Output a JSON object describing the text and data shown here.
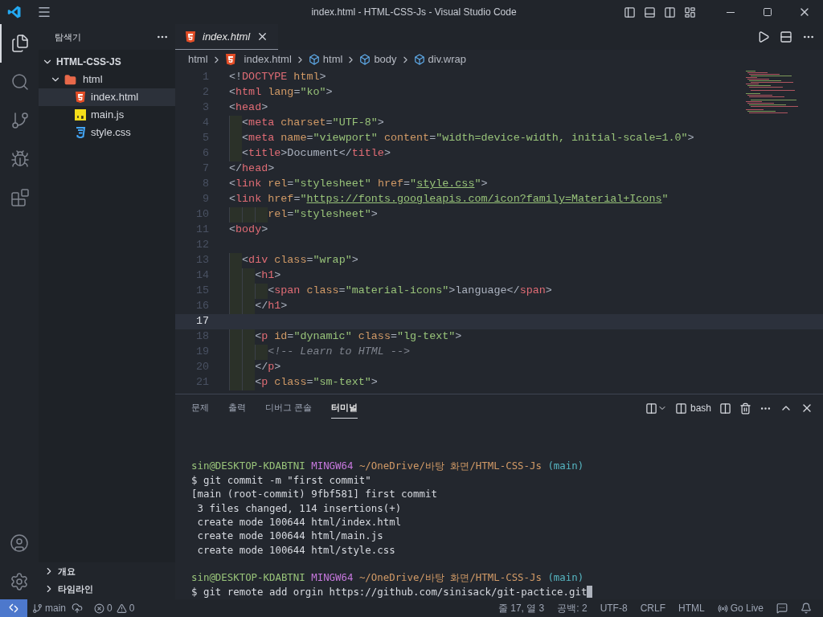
{
  "window": {
    "title": "index.html - HTML-CSS-Js - Visual Studio Code"
  },
  "activity_bar": [
    {
      "kind": "explorer",
      "selected": true
    },
    {
      "kind": "search",
      "selected": false
    },
    {
      "kind": "source-control",
      "selected": false
    },
    {
      "kind": "run",
      "selected": false
    },
    {
      "kind": "extensions",
      "selected": false
    }
  ],
  "sidebar": {
    "title": "탐색기",
    "tree": [
      {
        "label": "HTML-CSS-JS",
        "kind": "root",
        "expanded": true,
        "children": [
          {
            "label": "html",
            "kind": "folder",
            "expanded": true,
            "selected": false,
            "children": [
              {
                "label": "index.html",
                "kind": "html",
                "selected": true
              },
              {
                "label": "main.js",
                "kind": "js",
                "selected": false
              },
              {
                "label": "style.css",
                "kind": "css",
                "selected": false
              }
            ]
          }
        ]
      }
    ],
    "sections": [
      {
        "label": "개요",
        "expanded": false
      },
      {
        "label": "타임라인",
        "expanded": false
      }
    ]
  },
  "tabs": [
    {
      "label": "index.html",
      "kind": "html",
      "selected": true
    }
  ],
  "breadcrumbs": [
    {
      "label": "html",
      "kind": "folder"
    },
    {
      "label": "index.html",
      "kind": "html"
    },
    {
      "label": "html",
      "kind": "element"
    },
    {
      "label": "body",
      "kind": "element"
    },
    {
      "label": "div.wrap",
      "kind": "element"
    }
  ],
  "editor": {
    "lines": [
      {
        "number": "1",
        "current": false,
        "tokens": [
          {
            "kind": "punct",
            "text": "<!"
          },
          {
            "kind": "tag",
            "text": "DOCTYPE"
          },
          {
            "kind": "attr",
            "text": " html"
          },
          {
            "kind": "punct",
            "text": ">"
          }
        ]
      },
      {
        "number": "2",
        "current": false,
        "tokens": [
          {
            "kind": "punct",
            "text": "<"
          },
          {
            "kind": "tag",
            "text": "html"
          },
          {
            "kind": "attr",
            "text": " lang"
          },
          {
            "kind": "punct",
            "text": "="
          },
          {
            "kind": "string",
            "text": "\"ko\""
          },
          {
            "kind": "punct",
            "text": ">"
          }
        ]
      },
      {
        "number": "3",
        "current": false,
        "tokens": [
          {
            "kind": "punct",
            "text": "<"
          },
          {
            "kind": "tag",
            "text": "head"
          },
          {
            "kind": "punct",
            "text": ">"
          }
        ]
      },
      {
        "number": "4",
        "current": false,
        "tokens": [
          {
            "kind": "punct",
            "text": "  <"
          },
          {
            "kind": "tag",
            "text": "meta"
          },
          {
            "kind": "attr",
            "text": " charset"
          },
          {
            "kind": "punct",
            "text": "="
          },
          {
            "kind": "string",
            "text": "\"UTF-8\""
          },
          {
            "kind": "punct",
            "text": ">"
          }
        ]
      },
      {
        "number": "5",
        "current": false,
        "tokens": [
          {
            "kind": "punct",
            "text": "  <"
          },
          {
            "kind": "tag",
            "text": "meta"
          },
          {
            "kind": "attr",
            "text": " name"
          },
          {
            "kind": "punct",
            "text": "="
          },
          {
            "kind": "string",
            "text": "\"viewport\""
          },
          {
            "kind": "attr",
            "text": " content"
          },
          {
            "kind": "punct",
            "text": "="
          },
          {
            "kind": "string",
            "text": "\"width=device-width, initial-scale=1.0\""
          },
          {
            "kind": "punct",
            "text": ">"
          }
        ]
      },
      {
        "number": "6",
        "current": false,
        "tokens": [
          {
            "kind": "punct",
            "text": "  <"
          },
          {
            "kind": "tag",
            "text": "title"
          },
          {
            "kind": "punct",
            "text": ">"
          },
          {
            "kind": "text",
            "text": "Document"
          },
          {
            "kind": "punct",
            "text": "</"
          },
          {
            "kind": "tag",
            "text": "title"
          },
          {
            "kind": "punct",
            "text": ">"
          }
        ]
      },
      {
        "number": "7",
        "current": false,
        "tokens": [
          {
            "kind": "punct",
            "text": "</"
          },
          {
            "kind": "tag",
            "text": "head"
          },
          {
            "kind": "punct",
            "text": ">"
          }
        ]
      },
      {
        "number": "8",
        "current": false,
        "tokens": [
          {
            "kind": "punct",
            "text": "<"
          },
          {
            "kind": "tag",
            "text": "link"
          },
          {
            "kind": "attr",
            "text": " rel"
          },
          {
            "kind": "punct",
            "text": "="
          },
          {
            "kind": "string",
            "text": "\"stylesheet\""
          },
          {
            "kind": "attr",
            "text": " href"
          },
          {
            "kind": "punct",
            "text": "="
          },
          {
            "kind": "string",
            "text": "\""
          },
          {
            "kind": "link",
            "text": "style.css"
          },
          {
            "kind": "string",
            "text": "\""
          },
          {
            "kind": "punct",
            "text": ">"
          }
        ]
      },
      {
        "number": "9",
        "current": false,
        "tokens": [
          {
            "kind": "punct",
            "text": "<"
          },
          {
            "kind": "tag",
            "text": "link"
          },
          {
            "kind": "attr",
            "text": " href"
          },
          {
            "kind": "punct",
            "text": "="
          },
          {
            "kind": "string",
            "text": "\""
          },
          {
            "kind": "link",
            "text": "https://fonts.googleapis.com/icon?family=Material+Icons"
          },
          {
            "kind": "string",
            "text": "\""
          }
        ]
      },
      {
        "number": "10",
        "current": false,
        "tokens": [
          {
            "kind": "attr",
            "text": "      rel"
          },
          {
            "kind": "punct",
            "text": "="
          },
          {
            "kind": "string",
            "text": "\"stylesheet\""
          },
          {
            "kind": "punct",
            "text": ">"
          }
        ]
      },
      {
        "number": "11",
        "current": false,
        "tokens": [
          {
            "kind": "punct",
            "text": "<"
          },
          {
            "kind": "tag",
            "text": "body"
          },
          {
            "kind": "punct",
            "text": ">"
          }
        ]
      },
      {
        "number": "12",
        "current": false
      },
      {
        "number": "13",
        "current": false,
        "tokens": [
          {
            "kind": "punct",
            "text": "  <"
          },
          {
            "kind": "tag",
            "text": "div"
          },
          {
            "kind": "attr",
            "text": " class"
          },
          {
            "kind": "punct",
            "text": "="
          },
          {
            "kind": "string",
            "text": "\"wrap\""
          },
          {
            "kind": "punct",
            "text": ">"
          }
        ]
      },
      {
        "number": "14",
        "current": false,
        "tokens": [
          {
            "kind": "punct",
            "text": "    <"
          },
          {
            "kind": "tag",
            "text": "h1"
          },
          {
            "kind": "punct",
            "text": ">"
          }
        ]
      },
      {
        "number": "15",
        "current": false,
        "tokens": [
          {
            "kind": "punct",
            "text": "      <"
          },
          {
            "kind": "tag",
            "text": "span"
          },
          {
            "kind": "attr",
            "text": " class"
          },
          {
            "kind": "punct",
            "text": "="
          },
          {
            "kind": "string",
            "text": "\"material-icons\""
          },
          {
            "kind": "punct",
            "text": ">"
          },
          {
            "kind": "text",
            "text": "language"
          },
          {
            "kind": "punct",
            "text": "</"
          },
          {
            "kind": "tag",
            "text": "span"
          },
          {
            "kind": "punct",
            "text": ">"
          }
        ]
      },
      {
        "number": "16",
        "current": false,
        "tokens": [
          {
            "kind": "punct",
            "text": "    </"
          },
          {
            "kind": "tag",
            "text": "h1"
          },
          {
            "kind": "punct",
            "text": ">"
          }
        ]
      },
      {
        "number": "17",
        "current": true
      },
      {
        "number": "18",
        "current": false,
        "tokens": [
          {
            "kind": "punct",
            "text": "    <"
          },
          {
            "kind": "tag",
            "text": "p"
          },
          {
            "kind": "attr",
            "text": " id"
          },
          {
            "kind": "punct",
            "text": "="
          },
          {
            "kind": "string",
            "text": "\"dynamic\""
          },
          {
            "kind": "attr",
            "text": " class"
          },
          {
            "kind": "punct",
            "text": "="
          },
          {
            "kind": "string",
            "text": "\"lg-text\""
          },
          {
            "kind": "punct",
            "text": ">"
          }
        ]
      },
      {
        "number": "19",
        "current": false,
        "tokens": [
          {
            "kind": "comment",
            "text": "      <!-- Learn to HTML -->"
          }
        ]
      },
      {
        "number": "20",
        "current": false,
        "tokens": [
          {
            "kind": "punct",
            "text": "    </"
          },
          {
            "kind": "tag",
            "text": "p"
          },
          {
            "kind": "punct",
            "text": ">"
          }
        ]
      },
      {
        "number": "21",
        "current": false,
        "tokens": [
          {
            "kind": "punct",
            "text": "    <"
          },
          {
            "kind": "tag",
            "text": "p"
          },
          {
            "kind": "attr",
            "text": " class"
          },
          {
            "kind": "punct",
            "text": "="
          },
          {
            "kind": "string",
            "text": "\"sm-text\""
          },
          {
            "kind": "punct",
            "text": ">"
          }
        ]
      }
    ]
  },
  "panel": {
    "tabs": [
      {
        "label": "문제",
        "selected": false
      },
      {
        "label": "출력",
        "selected": false
      },
      {
        "label": "디버그 콘솔",
        "selected": false
      },
      {
        "label": "터미널",
        "selected": true
      }
    ],
    "shell": "bash",
    "terminal": {
      "cursor": true,
      "blocks": [
        [
          [
            {
              "kind": "user",
              "text": "sin@DESKTOP-KDABTNI"
            },
            {
              "kind": "system",
              "text": " MINGW64"
            },
            {
              "kind": "path",
              "text": " ~/OneDrive/바탕 화면/HTML-CSS-Js"
            },
            {
              "kind": "branch",
              "text": " (main)"
            }
          ],
          [
            {
              "kind": "plain",
              "text": "$ git commit -m \"first commit\""
            }
          ],
          [
            {
              "kind": "plain",
              "text": "[main (root-commit) 9fbf581] first commit"
            }
          ],
          [
            {
              "kind": "plain",
              "text": " 3 files changed, 114 insertions(+)"
            }
          ],
          [
            {
              "kind": "plain",
              "text": " create mode 100644 html/index.html"
            }
          ],
          [
            {
              "kind": "plain",
              "text": " create mode 100644 html/main.js"
            }
          ],
          [
            {
              "kind": "plain",
              "text": " create mode 100644 html/style.css"
            }
          ]
        ],
        [
          [
            {
              "kind": "user",
              "text": "sin@DESKTOP-KDABTNI"
            },
            {
              "kind": "system",
              "text": " MINGW64"
            },
            {
              "kind": "path",
              "text": " ~/OneDrive/바탕 화면/HTML-CSS-Js"
            },
            {
              "kind": "branch",
              "text": " (main)"
            }
          ],
          [
            {
              "kind": "plain",
              "text": "$ git remote add orgin https://github.com/sinisack/git-pactice.git"
            }
          ]
        ]
      ]
    }
  },
  "status_bar": {
    "branch": "main",
    "errors": "0",
    "warnings": "0",
    "right": [
      {
        "label": "줄 17, 열 3",
        "kind": "text"
      },
      {
        "label": "공백: 2",
        "kind": "text"
      },
      {
        "label": "UTF-8",
        "kind": "text"
      },
      {
        "label": "CRLF",
        "kind": "text"
      },
      {
        "label": "HTML",
        "kind": "text"
      },
      {
        "label": "Go Live",
        "kind": "live"
      },
      {
        "kind": "feedback"
      },
      {
        "kind": "bell"
      }
    ]
  }
}
